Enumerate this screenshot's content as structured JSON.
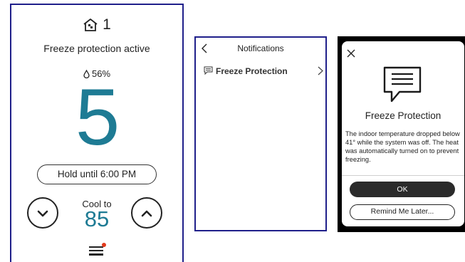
{
  "thermostat": {
    "zone_number": "1",
    "status_text": "Freeze protection active",
    "humidity": "56%",
    "current_temp": "5",
    "hold_label": "Hold until 6:00 PM",
    "mode_label": "Cool to",
    "setpoint": "85",
    "accent_color": "#1e7b94",
    "alert_dot_color": "#e23a1c"
  },
  "notifications": {
    "title": "Notifications",
    "items": [
      {
        "label": "Freeze Protection"
      }
    ]
  },
  "dialog": {
    "title": "Freeze Protection",
    "body": "The indoor temperature dropped below 41° while the system was off. The heat was automatically turned on to prevent freezing.",
    "ok_label": "OK",
    "later_label": "Remind Me Later..."
  }
}
